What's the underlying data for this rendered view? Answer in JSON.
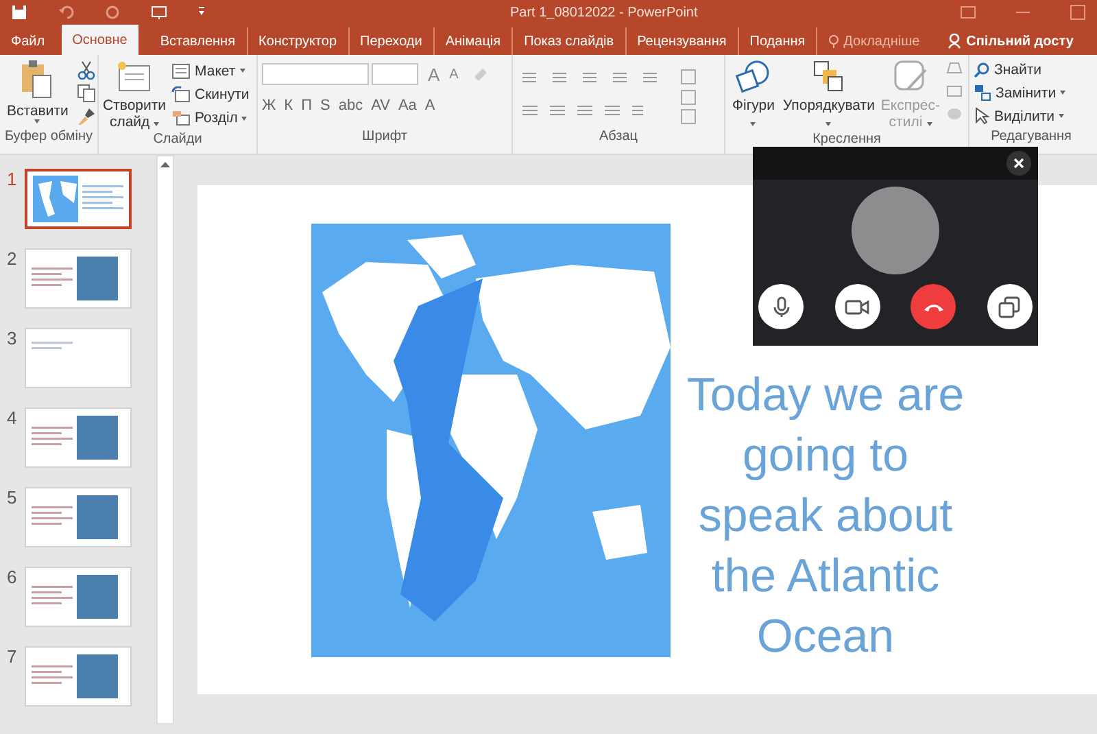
{
  "window": {
    "title": "Part 1_08012022 - PowerPoint"
  },
  "tabs": [
    {
      "label": "Файл",
      "kind": "file",
      "selected": false
    },
    {
      "label": "Основне",
      "kind": "tab",
      "selected": true
    },
    {
      "label": "Вставлення",
      "kind": "tab",
      "selected": false
    },
    {
      "label": "Конструктор",
      "kind": "tab",
      "selected": false
    },
    {
      "label": "Переходи",
      "kind": "tab",
      "selected": false
    },
    {
      "label": "Анімація",
      "kind": "tab",
      "selected": false
    },
    {
      "label": "Показ слайдів",
      "kind": "tab",
      "selected": false
    },
    {
      "label": "Рецензування",
      "kind": "tab",
      "selected": false
    },
    {
      "label": "Подання",
      "kind": "tab",
      "selected": false
    },
    {
      "label": "Докладніше",
      "kind": "tell_me",
      "selected": false
    },
    {
      "label": "Спільний досту",
      "kind": "share",
      "selected": false
    }
  ],
  "ribbon": {
    "clipboard": {
      "label": "Буфер обміну",
      "paste": "Вставити"
    },
    "slides": {
      "label": "Слайди",
      "new_slide": "Створити слайд",
      "items": [
        {
          "label": "Макет",
          "kind": "layout"
        },
        {
          "label": "Скинути",
          "kind": "reset"
        },
        {
          "label": "Розділ",
          "kind": "section"
        }
      ]
    },
    "font": {
      "label": "Шрифт",
      "size_buttons": [
        "A",
        "A"
      ],
      "format_buttons": [
        "Ж",
        "К",
        "П",
        "S",
        "abc",
        "AV",
        "Aa",
        "A"
      ]
    },
    "paragraph": {
      "label": "Абзац"
    },
    "drawing": {
      "label": "Креслення",
      "items": [
        {
          "label": "Фігури",
          "kind": "shapes",
          "disabled": false
        },
        {
          "label": "Упорядкувати",
          "kind": "arrange",
          "disabled": false
        },
        {
          "label": "Експрес-стилі",
          "kind": "styles",
          "disabled": true
        }
      ]
    },
    "editing": {
      "label": "Редагування",
      "items": [
        {
          "label": "Знайти",
          "kind": "find"
        },
        {
          "label": "Замінити",
          "kind": "replace"
        },
        {
          "label": "Виділити",
          "kind": "select"
        }
      ]
    }
  },
  "thumbnails": [
    {
      "number": "1",
      "kind": "map",
      "selected": true
    },
    {
      "number": "2",
      "kind": "image",
      "selected": false
    },
    {
      "number": "3",
      "kind": "text",
      "selected": false
    },
    {
      "number": "4",
      "kind": "image",
      "selected": false
    },
    {
      "number": "5",
      "kind": "image",
      "selected": false
    },
    {
      "number": "6",
      "kind": "image",
      "selected": false
    },
    {
      "number": "7",
      "kind": "image",
      "selected": false
    }
  ],
  "slide": {
    "title": "Today we are going to speak about the Atlantic Ocean"
  },
  "call": {
    "buttons": [
      {
        "kind": "mic"
      },
      {
        "kind": "camera"
      },
      {
        "kind": "hangup"
      },
      {
        "kind": "popout"
      }
    ]
  }
}
